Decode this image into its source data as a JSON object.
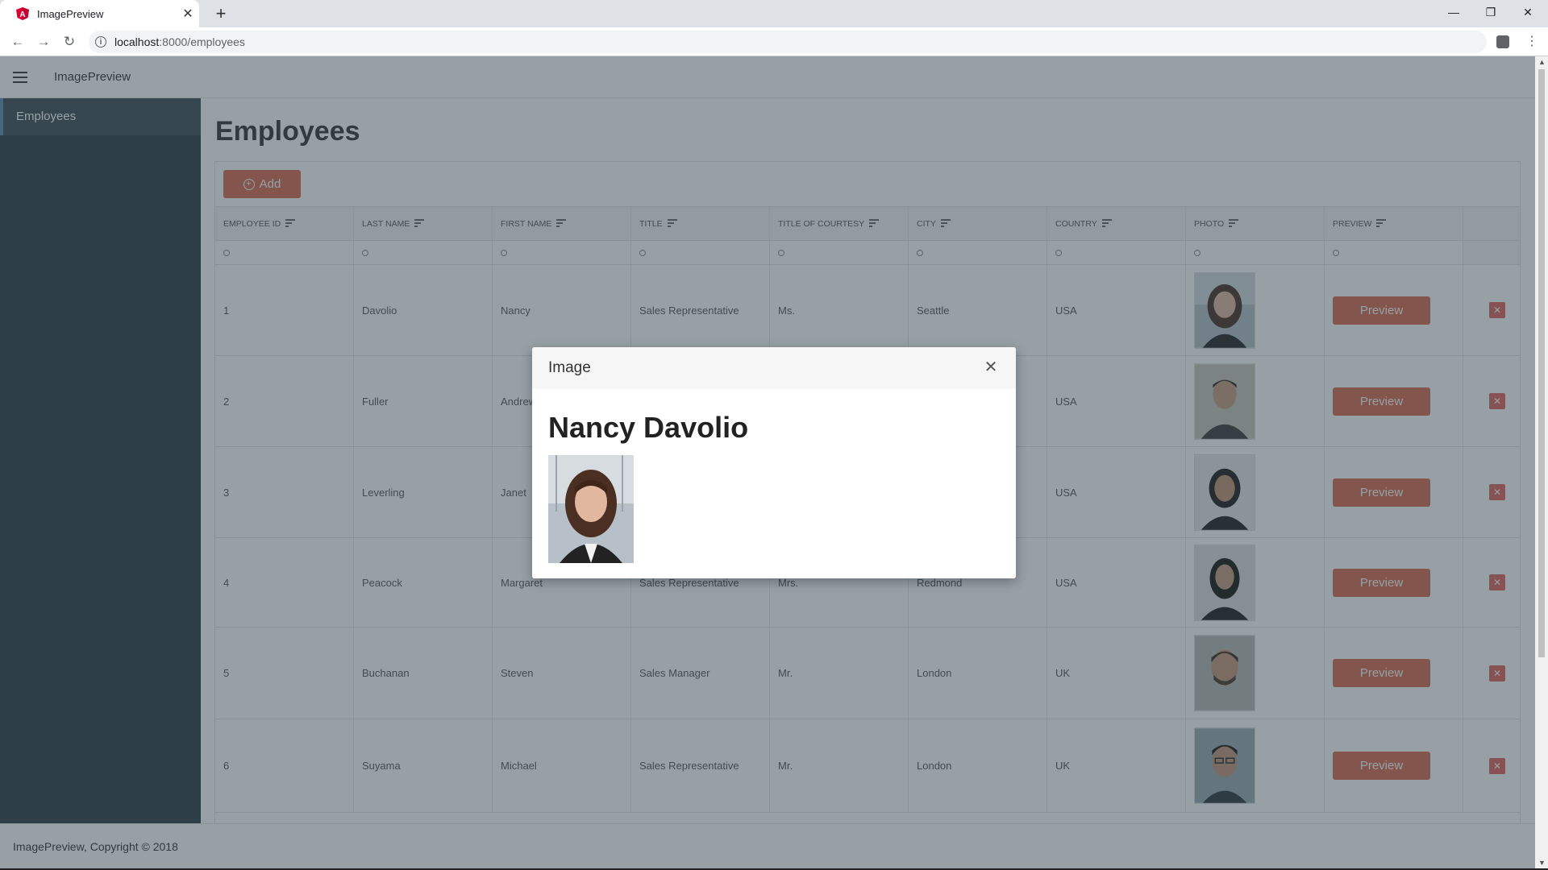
{
  "browser": {
    "tab_title": "ImagePreview",
    "url_host": "localhost",
    "url_path": ":8000/employees"
  },
  "app": {
    "title": "ImagePreview",
    "sidebar": [
      {
        "label": "Employees"
      }
    ],
    "page_title": "Employees",
    "add_label": "Add",
    "footer": "ImagePreview, Copyright © 2018"
  },
  "table": {
    "columns": [
      "EMPLOYEE ID",
      "LAST NAME",
      "FIRST NAME",
      "TITLE",
      "TITLE OF COURTESY",
      "CITY",
      "COUNTRY",
      "PHOTO",
      "PREVIEW"
    ],
    "preview_label": "Preview",
    "rows": [
      {
        "id": "1",
        "last": "Davolio",
        "first": "Nancy",
        "title": "Sales Representative",
        "courtesy": "Ms.",
        "city": "Seattle",
        "country": "USA"
      },
      {
        "id": "2",
        "last": "Fuller",
        "first": "Andrew",
        "title": "",
        "courtesy": "",
        "city": "",
        "country": "USA"
      },
      {
        "id": "3",
        "last": "Leverling",
        "first": "Janet",
        "title": "",
        "courtesy": "",
        "city": "",
        "country": "USA"
      },
      {
        "id": "4",
        "last": "Peacock",
        "first": "Margaret",
        "title": "Sales Representative",
        "courtesy": "Mrs.",
        "city": "Redmond",
        "country": "USA"
      },
      {
        "id": "5",
        "last": "Buchanan",
        "first": "Steven",
        "title": "Sales Manager",
        "courtesy": "Mr.",
        "city": "London",
        "country": "UK"
      },
      {
        "id": "6",
        "last": "Suyama",
        "first": "Michael",
        "title": "Sales Representative",
        "courtesy": "Mr.",
        "city": "London",
        "country": "UK"
      }
    ]
  },
  "modal": {
    "title": "Image",
    "heading": "Nancy Davolio"
  },
  "colors": {
    "accent": "#d9684d",
    "sidebar": "#2d3a41",
    "overlay": "rgba(46,66,76,0.5)"
  }
}
